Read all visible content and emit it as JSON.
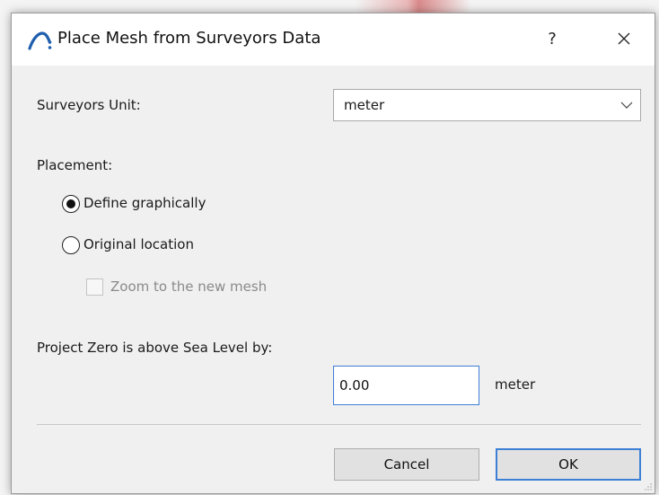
{
  "dialog": {
    "title": "Place Mesh from Surveyors Data",
    "help_label": "?",
    "close_label": "Close"
  },
  "surveyors_unit": {
    "label": "Surveyors Unit:",
    "selected": "meter"
  },
  "placement": {
    "label": "Placement:",
    "options": [
      {
        "label": "Define graphically",
        "checked": true
      },
      {
        "label": "Original location",
        "checked": false
      }
    ],
    "zoom_checkbox": {
      "label": "Zoom to the new mesh",
      "checked": false,
      "enabled": false
    }
  },
  "project_zero": {
    "label": "Project Zero is above Sea Level by:",
    "value": "0.00",
    "unit": "meter"
  },
  "buttons": {
    "cancel": "Cancel",
    "ok": "OK"
  },
  "icons": {
    "app": "archicad-mesh-icon",
    "close": "close-icon",
    "dropdown": "chevron-down-icon"
  },
  "colors": {
    "accent": "#3d7fd6",
    "app_icon": "#1f5fae",
    "dialog_bg": "#f0f0f0"
  }
}
